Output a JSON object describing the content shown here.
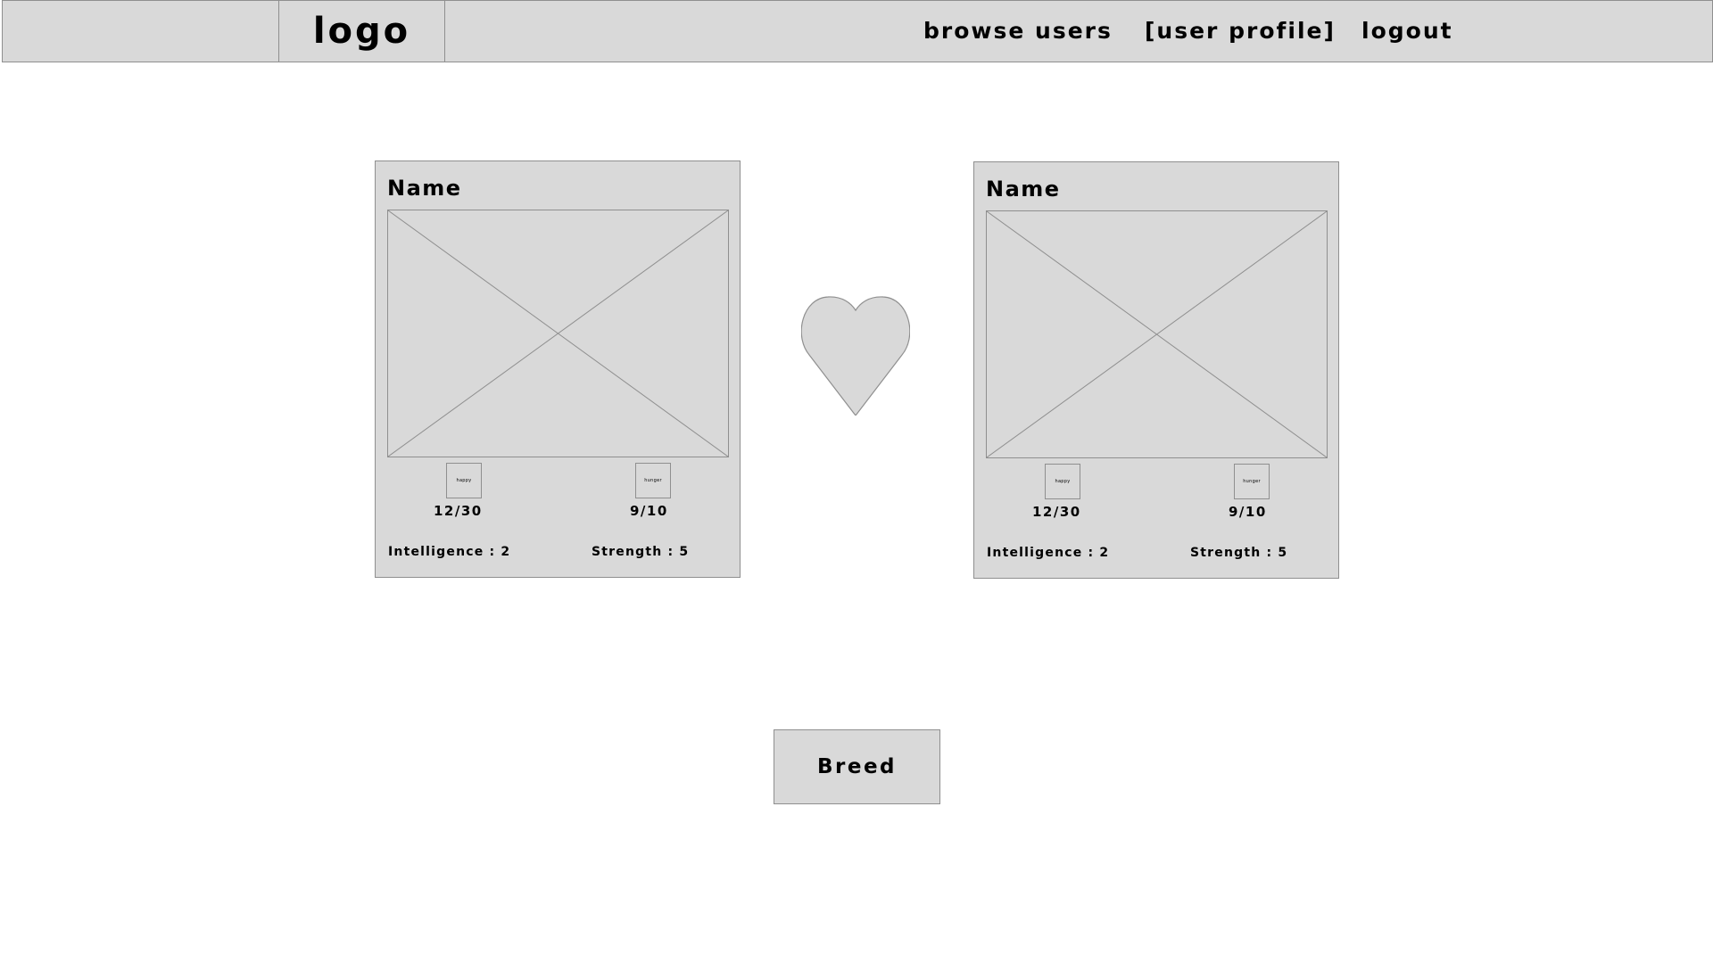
{
  "header": {
    "logo": "logo",
    "nav": {
      "browse_users": "browse users",
      "user_profile": "[user profile]",
      "logout": "logout"
    }
  },
  "cards": [
    {
      "name": "Name",
      "happy_label": "happy",
      "hunger_label": "hunger",
      "happy_value": "12/30",
      "hunger_value": "9/10",
      "intelligence": "Intelligence : 2",
      "strength": "Strength : 5"
    },
    {
      "name": "Name",
      "happy_label": "happy",
      "hunger_label": "hunger",
      "happy_value": "12/30",
      "hunger_value": "9/10",
      "intelligence": "Intelligence : 2",
      "strength": "Strength : 5"
    }
  ],
  "breed_button": "Breed",
  "colors": {
    "panel": "#d9d9d9",
    "border": "#8f8f8f",
    "text": "#000000"
  }
}
